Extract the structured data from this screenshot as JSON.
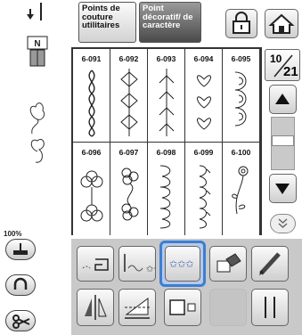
{
  "tabs": {
    "utility": "Points de couture utilitaires",
    "decorative": "Point décoratif/ de caractère"
  },
  "page": {
    "current": "10",
    "total": "21"
  },
  "zoom": "100%",
  "stitches": [
    {
      "code": "6-091"
    },
    {
      "code": "6-092"
    },
    {
      "code": "6-093"
    },
    {
      "code": "6-094"
    },
    {
      "code": "6-095"
    },
    {
      "code": "6-096"
    },
    {
      "code": "6-097"
    },
    {
      "code": "6-098"
    },
    {
      "code": "6-099"
    },
    {
      "code": "6-100"
    }
  ],
  "colors": {
    "active_tab": "#555555",
    "selected_frame": "#3a7fd5",
    "panel_gray": "#c9c9c9"
  },
  "icons": {
    "needle": "needle-position-icon",
    "foot": "presser-foot-N-icon",
    "lock": "lock-icon",
    "home": "home-icon",
    "up": "arrow-up-icon",
    "down": "arrow-down-icon",
    "expand": "chevron-double-down-icon"
  }
}
